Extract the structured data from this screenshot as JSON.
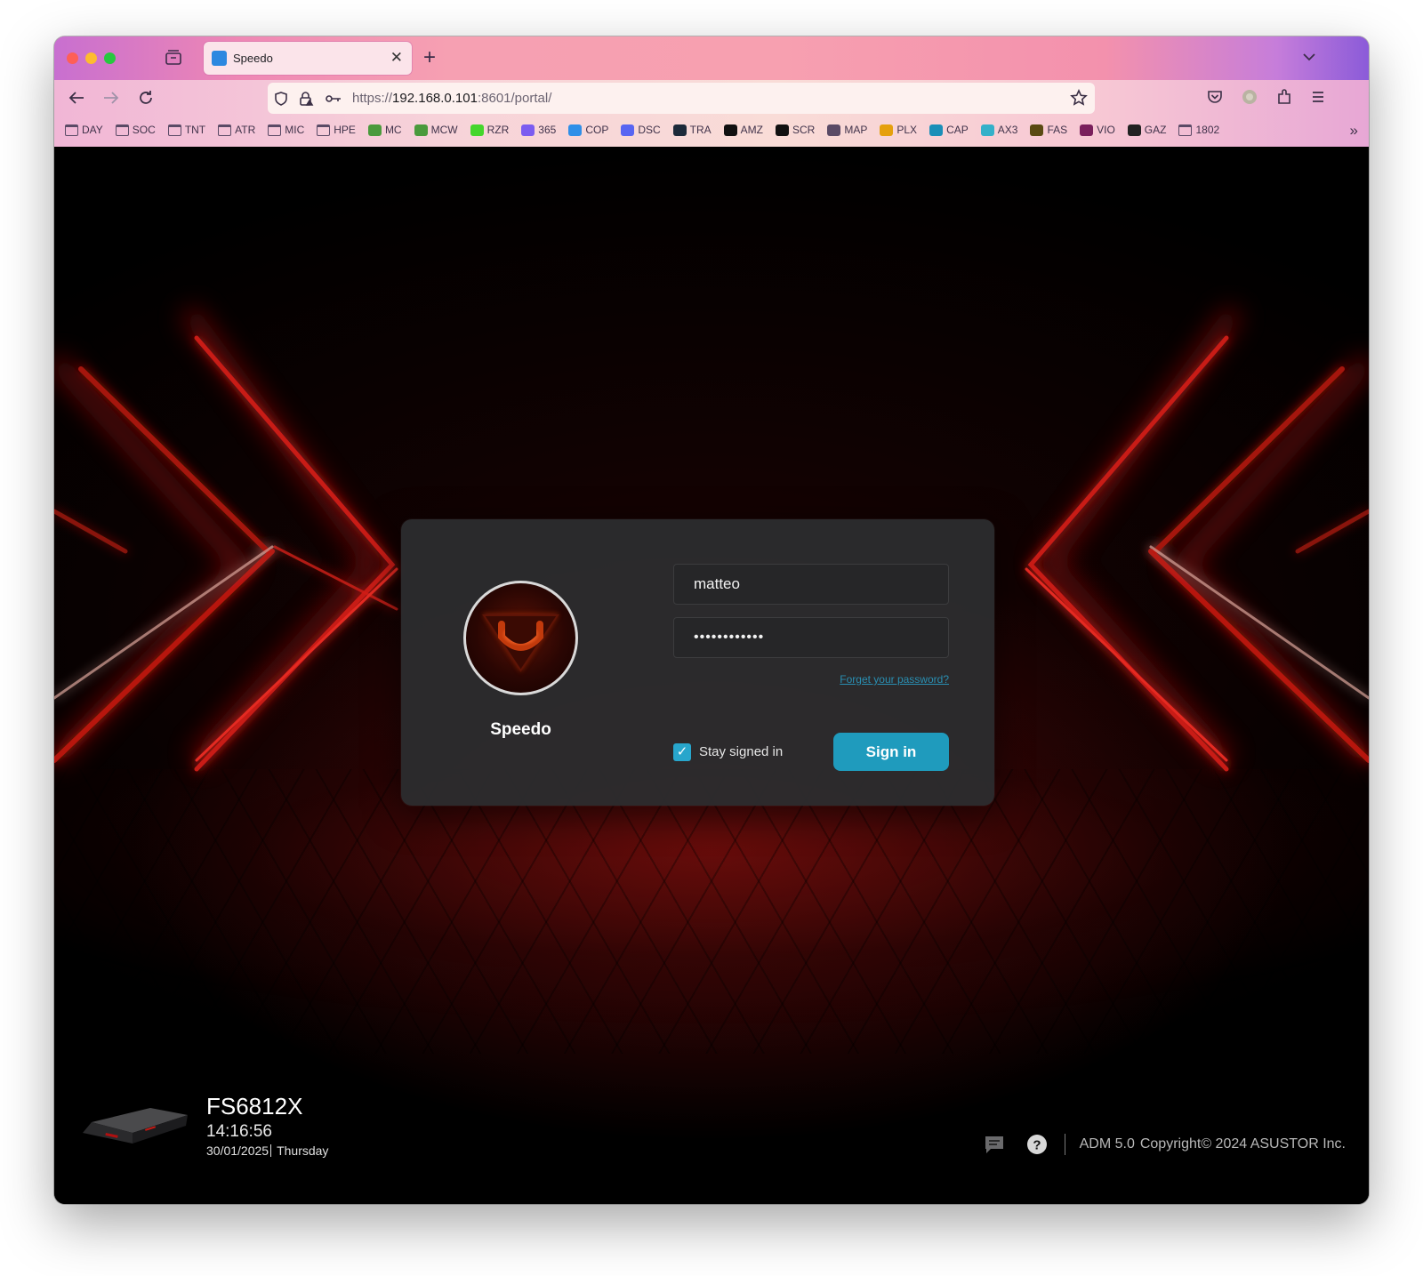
{
  "browser": {
    "tab_title": "Speedo",
    "url_scheme": "https://",
    "url_host": "192.168.0.101",
    "url_rest": ":8601/portal/",
    "bookmarks": [
      {
        "label": "DAY",
        "icon": "folder-icon"
      },
      {
        "label": "SOC",
        "icon": "folder-icon"
      },
      {
        "label": "TNT",
        "icon": "folder-icon"
      },
      {
        "label": "ATR",
        "icon": "folder-icon"
      },
      {
        "label": "MIC",
        "icon": "folder-icon"
      },
      {
        "label": "HPE",
        "icon": "folder-icon"
      },
      {
        "label": "MC",
        "icon": "meraki-icon",
        "color": "#4a9a3c"
      },
      {
        "label": "MCW",
        "icon": "meraki-icon",
        "color": "#4a9a3c"
      },
      {
        "label": "RZR",
        "icon": "razer-icon",
        "color": "#44d62c"
      },
      {
        "label": "365",
        "icon": "copilot-icon",
        "color": "#7b5cf0"
      },
      {
        "label": "COP",
        "icon": "copilot-icon",
        "color": "#2f8fe8"
      },
      {
        "label": "DSC",
        "icon": "discord-icon",
        "color": "#5865f2"
      },
      {
        "label": "TRA",
        "icon": "tra-icon",
        "color": "#1c2a3a"
      },
      {
        "label": "AMZ",
        "icon": "amazon-icon",
        "color": "#111111"
      },
      {
        "label": "SCR",
        "icon": "scr-icon",
        "color": "#111111"
      },
      {
        "label": "MAP",
        "icon": "globe-icon",
        "color": "#5a4a66"
      },
      {
        "label": "PLX",
        "icon": "plex-icon",
        "color": "#e5a00d"
      },
      {
        "label": "CAP",
        "icon": "cap-icon",
        "color": "#1a8fb8"
      },
      {
        "label": "AX3",
        "icon": "tplink-icon",
        "color": "#34b0c9"
      },
      {
        "label": "FAS",
        "icon": "fas-icon",
        "color": "#5a4a12"
      },
      {
        "label": "VIO",
        "icon": "vio-icon",
        "color": "#7a1f5c"
      },
      {
        "label": "GAZ",
        "icon": "gaz-icon",
        "color": "#222222"
      },
      {
        "label": "1802",
        "icon": "folder-icon"
      }
    ]
  },
  "login": {
    "server_name": "Speedo",
    "username_value": "matteo",
    "password_value": "••••••••••••",
    "forget_link": "Forget your password?",
    "stay_signed_in_label": "Stay signed in",
    "stay_signed_in_checked": true,
    "sign_in_label": "Sign in"
  },
  "device": {
    "model": "FS6812X",
    "time": "14:16:56",
    "date": "30/01/2025",
    "weekday": "Thursday"
  },
  "footer": {
    "version_text": "ADM 5.0",
    "copyright": "Copyright© 2024 ASUSTOR Inc."
  },
  "colors": {
    "accent": "#1f9bbd",
    "link": "#2a8fb2",
    "neon_red": "#e0201a"
  }
}
